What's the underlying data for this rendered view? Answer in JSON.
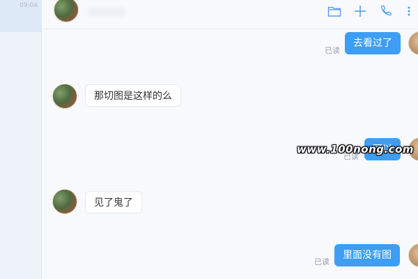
{
  "conversation_list": {
    "active_item": {
      "time": "09:04"
    }
  },
  "header": {
    "contact_name": "",
    "icons": [
      "folder-icon",
      "plus-icon",
      "phone-icon",
      "more-icon"
    ]
  },
  "messages": [
    {
      "direction": "out",
      "text": "去看过了",
      "status": "已读"
    },
    {
      "direction": "in",
      "text": "那切图是这样的么"
    },
    {
      "direction": "out",
      "text": "可以",
      "status": "已读"
    },
    {
      "direction": "in",
      "text": "见了鬼了"
    },
    {
      "direction": "out",
      "text": "里面没有图",
      "status": "已读"
    }
  ],
  "watermark": "www.100nong.com",
  "colors": {
    "outgoing_bubble": "#3d9ef4",
    "incoming_bubble": "#ffffff",
    "background": "#f7f9fc",
    "read_status": "#9aa1aa"
  }
}
